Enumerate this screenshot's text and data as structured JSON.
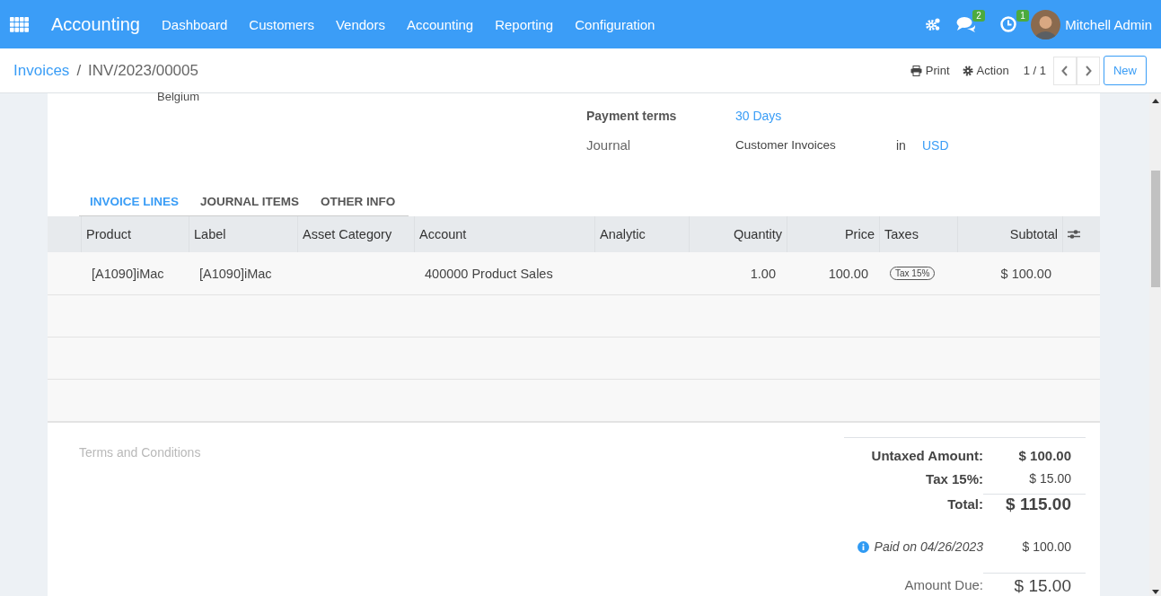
{
  "navbar": {
    "app_name": "Accounting",
    "menu": [
      "Dashboard",
      "Customers",
      "Vendors",
      "Accounting",
      "Reporting",
      "Configuration"
    ],
    "messages_count": "2",
    "activities_count": "1",
    "user": "Mitchell Admin"
  },
  "control_panel": {
    "breadcrumb": [
      {
        "label": "Invoices",
        "kind": "link"
      },
      {
        "label": "INV/2023/00005",
        "kind": "current"
      }
    ],
    "breadcrumb_separator": "/",
    "print": "Print",
    "action": "Action",
    "pager": "1 / 1",
    "new_button": "New"
  },
  "partner_address_tail": "Belgium",
  "fields": [
    {
      "label": "Payment terms",
      "value": "30 Days",
      "kind": "link"
    },
    {
      "label": "Journal",
      "value": "Customer Invoices",
      "connector": "in",
      "currency": "USD",
      "kind": "journal"
    }
  ],
  "tabs": [
    {
      "label": "INVOICE LINES",
      "selected": true
    },
    {
      "label": "JOURNAL ITEMS",
      "selected": false
    },
    {
      "label": "OTHER INFO",
      "selected": false
    }
  ],
  "table": {
    "columns": [
      {
        "label": "Product"
      },
      {
        "label": "Label"
      },
      {
        "label": "Asset Category"
      },
      {
        "label": "Account"
      },
      {
        "label": "Analytic"
      },
      {
        "label": "Quantity"
      },
      {
        "label": "Price"
      },
      {
        "label": "Taxes"
      },
      {
        "label": "Subtotal"
      }
    ],
    "rows": [
      {
        "cells": [
          "[A1090]iMac",
          "[A1090]iMac",
          "",
          "400000 Product Sales",
          "",
          "1.00",
          "100.00",
          "",
          "$ 100.00"
        ],
        "tax_tags": [
          "Tax 15%"
        ]
      }
    ]
  },
  "terms_placeholder": "Terms and Conditions",
  "totals": [
    {
      "label": "Untaxed Amount:",
      "value": "$ 100.00",
      "kind": "subtotal"
    },
    {
      "label": "Tax 15%:",
      "value": "$ 15.00",
      "kind": "tax"
    },
    {
      "label": "Total:",
      "value": "$ 115.00",
      "kind": "total"
    },
    {
      "label": "Paid on 04/26/2023",
      "value": "$ 100.00",
      "kind": "payment"
    },
    {
      "label": "Amount Due:",
      "value": "$ 15.00",
      "kind": "due"
    }
  ]
}
